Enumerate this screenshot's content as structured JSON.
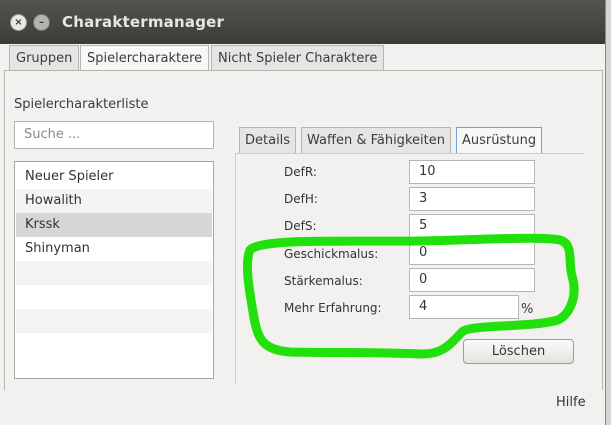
{
  "window": {
    "title": "Charaktermanager"
  },
  "top_tabs": [
    {
      "label": "Gruppen"
    },
    {
      "label": "Spielercharaktere"
    },
    {
      "label": "Nicht Spieler Charaktere"
    }
  ],
  "list": {
    "title": "Spielercharakterliste",
    "search_placeholder": "Suche ...",
    "items": [
      {
        "label": "Neuer Spieler"
      },
      {
        "label": "Howalith"
      },
      {
        "label": "Krssk",
        "selected": true
      },
      {
        "label": "Shinyman"
      }
    ]
  },
  "inner_tabs": [
    {
      "label": "Details"
    },
    {
      "label": "Waffen & Fähigkeiten"
    },
    {
      "label": "Ausrüstung",
      "active": true
    }
  ],
  "fields": [
    {
      "label": "DefR:",
      "value": "10"
    },
    {
      "label": "DefH:",
      "value": "3"
    },
    {
      "label": "DefS:",
      "value": "5"
    },
    {
      "label": "Geschickmalus:",
      "value": "0"
    },
    {
      "label": "Stärkemalus:",
      "value": "0"
    },
    {
      "label": "Mehr Erfahrung:",
      "value": "4"
    }
  ],
  "percent_suffix": "%",
  "delete_button": "Löschen",
  "statusbar": {
    "help": "Hilfe"
  },
  "colors": {
    "highlight": "#22e00c",
    "titlebar": "#3c3b37",
    "selected_row": "#d6d6d6"
  }
}
